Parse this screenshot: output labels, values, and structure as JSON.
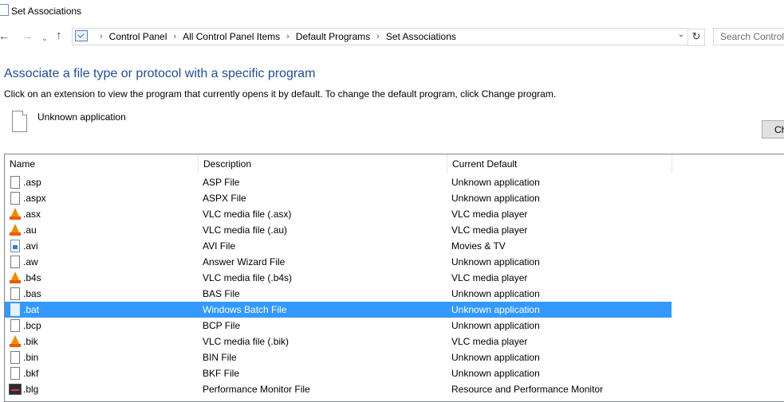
{
  "window": {
    "title": "Set Associations"
  },
  "nav": {
    "back": "←",
    "forward": "→",
    "recent": "⌄",
    "up": "↑",
    "refresh": "↻",
    "dropdown": "⌄"
  },
  "breadcrumbs": [
    "Control Panel",
    "All Control Panel Items",
    "Default Programs",
    "Set Associations"
  ],
  "search": {
    "placeholder": "Search Control Panel",
    "value": ""
  },
  "main": {
    "heading": "Associate a file type or protocol with a specific program",
    "instruction": "Click on an extension to view the program that currently opens it by default. To change the default program, click Change program.",
    "current_app": "Unknown application",
    "change_button": "Change program..."
  },
  "table": {
    "columns": [
      "Name",
      "Description",
      "Current Default"
    ],
    "rows": [
      {
        "name": ".asp",
        "description": "ASP File",
        "current_default": "Unknown application",
        "icon": "blank-file-icon"
      },
      {
        "name": ".aspx",
        "description": "ASPX File",
        "current_default": "Unknown application",
        "icon": "blank-file-icon"
      },
      {
        "name": ".asx",
        "description": "VLC media file (.asx)",
        "current_default": "VLC media player",
        "icon": "vlc-cone-icon"
      },
      {
        "name": ".au",
        "description": "VLC media file (.au)",
        "current_default": "VLC media player",
        "icon": "vlc-cone-icon"
      },
      {
        "name": ".avi",
        "description": "AVI File",
        "current_default": "Movies & TV",
        "icon": "video-file-icon"
      },
      {
        "name": ".aw",
        "description": "Answer Wizard File",
        "current_default": "Unknown application",
        "icon": "blank-file-icon"
      },
      {
        "name": ".b4s",
        "description": "VLC media file (.b4s)",
        "current_default": "VLC media player",
        "icon": "vlc-cone-icon"
      },
      {
        "name": ".bas",
        "description": "BAS File",
        "current_default": "Unknown application",
        "icon": "blank-file-icon"
      },
      {
        "name": ".bat",
        "description": "Windows Batch File",
        "current_default": "Unknown application",
        "icon": "blank-file-icon",
        "selected": true
      },
      {
        "name": ".bcp",
        "description": "BCP File",
        "current_default": "Unknown application",
        "icon": "blank-file-icon"
      },
      {
        "name": ".bik",
        "description": "VLC media file (.bik)",
        "current_default": "VLC media player",
        "icon": "vlc-cone-icon"
      },
      {
        "name": ".bin",
        "description": "BIN File",
        "current_default": "Unknown application",
        "icon": "blank-file-icon"
      },
      {
        "name": ".bkf",
        "description": "BKF File",
        "current_default": "Unknown application",
        "icon": "blank-file-icon"
      },
      {
        "name": ".blg",
        "description": "Performance Monitor File",
        "current_default": "Resource and Performance Monitor",
        "icon": "performance-monitor-icon"
      }
    ]
  },
  "colors": {
    "heading": "#1e4e9c",
    "selection": "#3399ff",
    "vlc": "#f48b00"
  }
}
